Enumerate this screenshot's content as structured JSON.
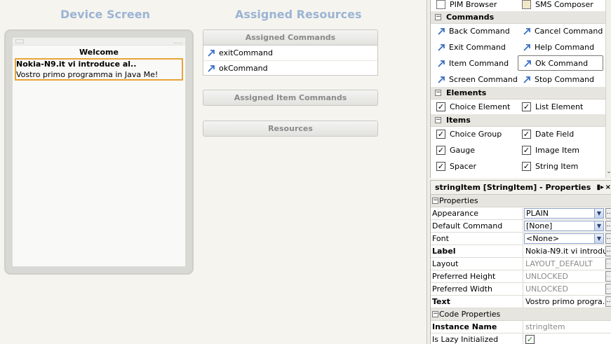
{
  "design": {
    "device_screen_title": "Device Screen",
    "assigned_resources_title": "Assigned Resources",
    "screen": {
      "title": "Welcome",
      "string_item": {
        "label": "Nokia-N9.it vi introduce al..",
        "text": "Vostro primo programma in Java Me!"
      }
    },
    "assigned_commands_header": "Assigned Commands",
    "assigned_commands": [
      "exitCommand",
      "okCommand"
    ],
    "assigned_item_commands_header": "Assigned Item Commands",
    "resources_header": "Resources"
  },
  "palette": {
    "top_items": [
      "PIM Browser",
      "SMS Composer"
    ],
    "categories": [
      {
        "name": "Commands",
        "items": [
          "Back Command",
          "Cancel Command",
          "Exit Command",
          "Help Command",
          "Item Command",
          "Ok Command",
          "Screen Command",
          "Stop Command"
        ],
        "selected": "Ok Command"
      },
      {
        "name": "Elements",
        "items": [
          "Choice Element",
          "List Element"
        ]
      },
      {
        "name": "Items",
        "items": [
          "Choice Group",
          "Date Field",
          "Gauge",
          "Image Item",
          "Spacer",
          "String Item"
        ]
      }
    ]
  },
  "properties": {
    "title": "stringItem [StringItem] - Properties",
    "section_properties": "Properties",
    "rows": [
      {
        "name": "Appearance",
        "value": "PLAIN"
      },
      {
        "name": "Default Command",
        "value": "[None]"
      },
      {
        "name": "Font",
        "value": "<None>"
      },
      {
        "name": "Label",
        "value": "Nokia-N9.it vi introdu..."
      },
      {
        "name": "Layout",
        "value": "LAYOUT_DEFAULT"
      },
      {
        "name": "Preferred Height",
        "value": "UNLOCKED"
      },
      {
        "name": "Preferred Width",
        "value": "UNLOCKED"
      },
      {
        "name": "Text",
        "value": "Vostro primo progra..."
      }
    ],
    "section_code": "Code Properties",
    "code_rows": [
      {
        "name": "Instance Name",
        "value": "stringItem"
      },
      {
        "name": "Is Lazy Initialized",
        "value": "✓"
      }
    ]
  },
  "colors": {
    "title_blue": "#9cb4d3",
    "focus_orange": "#e8a33a",
    "command_icon": "#3b6fc7"
  }
}
